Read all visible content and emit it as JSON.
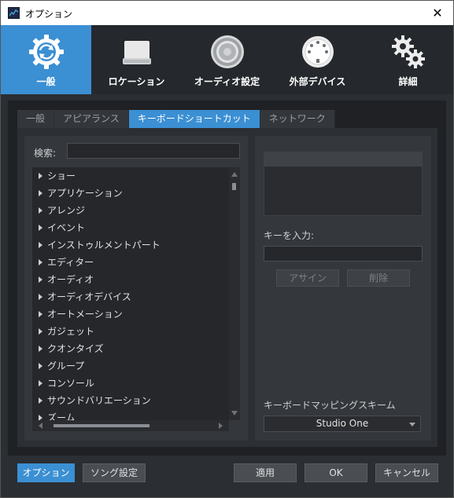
{
  "window": {
    "title": "オプション"
  },
  "categories": [
    {
      "label": "一般",
      "icon": "sync-gear-icon",
      "active": true
    },
    {
      "label": "ロケーション",
      "icon": "drive-icon",
      "active": false
    },
    {
      "label": "オーディオ設定",
      "icon": "speaker-icon",
      "active": false
    },
    {
      "label": "外部デバイス",
      "icon": "midi-port-icon",
      "active": false
    },
    {
      "label": "詳細",
      "icon": "gears-icon",
      "active": false
    }
  ],
  "tabs": [
    {
      "label": "一般",
      "active": false
    },
    {
      "label": "アピアランス",
      "active": false
    },
    {
      "label": "キーボードショートカット",
      "active": true
    },
    {
      "label": "ネットワーク",
      "active": false
    }
  ],
  "search": {
    "label": "検索:",
    "value": ""
  },
  "tree": {
    "items": [
      "ショー",
      "アプリケーション",
      "アレンジ",
      "イベント",
      "インストゥルメントパート",
      "エディター",
      "オーディオ",
      "オーディオデバイス",
      "オートメーション",
      "ガジェット",
      "クオンタイズ",
      "グループ",
      "コンソール",
      "サウンドバリエーション",
      "ズーム"
    ]
  },
  "key_entry": {
    "label": "キーを入力:",
    "value": ""
  },
  "actions": {
    "assign": "アサイン",
    "delete": "削除"
  },
  "scheme": {
    "label": "キーボードマッピングスキーム",
    "selected": "Studio One"
  },
  "footer": {
    "options": "オプション",
    "song_settings": "ソング設定",
    "apply": "適用",
    "ok": "OK",
    "cancel": "キャンセル"
  },
  "colors": {
    "accent": "#3b8fd3",
    "background": "#2b2e32"
  }
}
